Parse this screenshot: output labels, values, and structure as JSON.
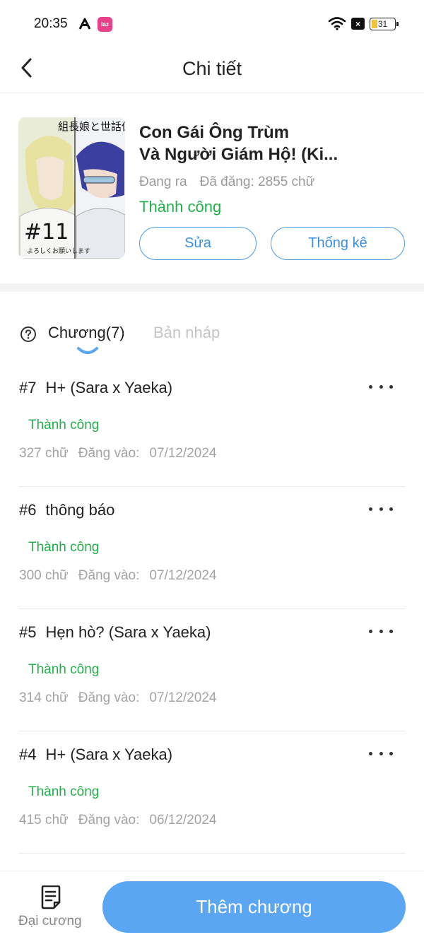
{
  "status_bar": {
    "time": "20:35",
    "app_icons": [
      "a-icon",
      "lazada-icon"
    ],
    "lazada_text": "laz",
    "battery": "31",
    "sim_text": "×"
  },
  "header": {
    "title": "Chi tiết",
    "back_icon": "chevron-left-icon"
  },
  "book": {
    "title_line1": "Con Gái Ông Trùm",
    "title_line2": "Và Người Giám Hộ! (Ki...",
    "state": "Đang ra",
    "posted": "Đã đăng: 2855 chữ",
    "status": "Thành công",
    "edit_label": "Sửa",
    "stats_label": "Thống kê",
    "cover_text": "#11"
  },
  "tabs": {
    "chapters": "Chương(7)",
    "drafts": "Bản nháp",
    "active": "chapters"
  },
  "chapters": [
    {
      "num": "#7",
      "title": "H+ (Sara x Yaeka)",
      "status": "Thành công",
      "words": "327 chữ",
      "date_label": "Đăng vào:",
      "date": "07/12/2024"
    },
    {
      "num": "#6",
      "title": "thông báo",
      "status": "Thành công",
      "words": "300 chữ",
      "date_label": "Đăng vào:",
      "date": "07/12/2024"
    },
    {
      "num": "#5",
      "title": "Hẹn hò? (Sara x Yaeka)",
      "status": "Thành công",
      "words": "314 chữ",
      "date_label": "Đăng vào:",
      "date": "07/12/2024"
    },
    {
      "num": "#4",
      "title": "H+ (Sara x Yaeka)",
      "status": "Thành công",
      "words": "415 chữ",
      "date_label": "Đăng vào:",
      "date": "06/12/2024"
    }
  ],
  "bottom_bar": {
    "outline_label": "Đại cương",
    "add_chapter_label": "Thêm chương"
  },
  "colors": {
    "accent": "#5aa6f3",
    "success": "#22b04b",
    "muted": "#9a9a9a"
  }
}
